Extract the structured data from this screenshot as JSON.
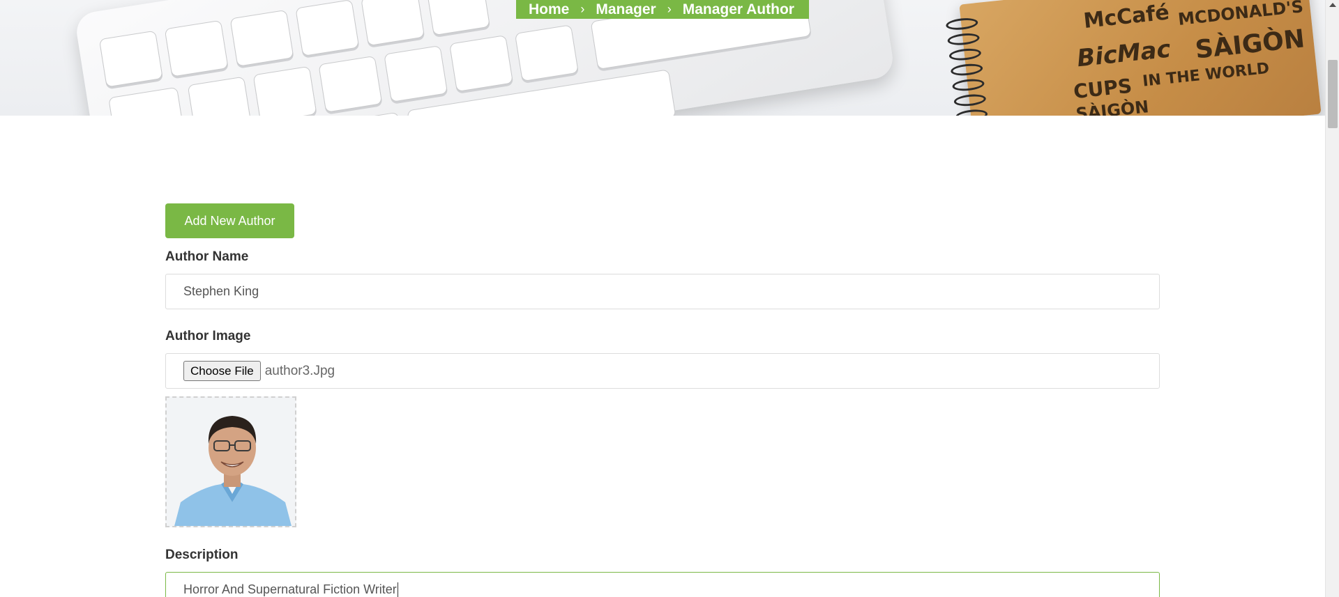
{
  "breadcrumb": {
    "items": [
      "Home",
      "Manager",
      "Manager Author"
    ],
    "separator": "›"
  },
  "form": {
    "add_button_label": "Add New Author",
    "author_name": {
      "label": "Author Name",
      "value": "Stephen King"
    },
    "author_image": {
      "label": "Author Image",
      "choose_label": "Choose File",
      "file_name": "author3.Jpg"
    },
    "description": {
      "label": "Description",
      "value": "Horror And Supernatural Fiction Writer"
    }
  },
  "colors": {
    "accent": "#7ab845"
  },
  "icons": [
    "chevron-right-icon",
    "scroll-up-arrow-icon"
  ]
}
